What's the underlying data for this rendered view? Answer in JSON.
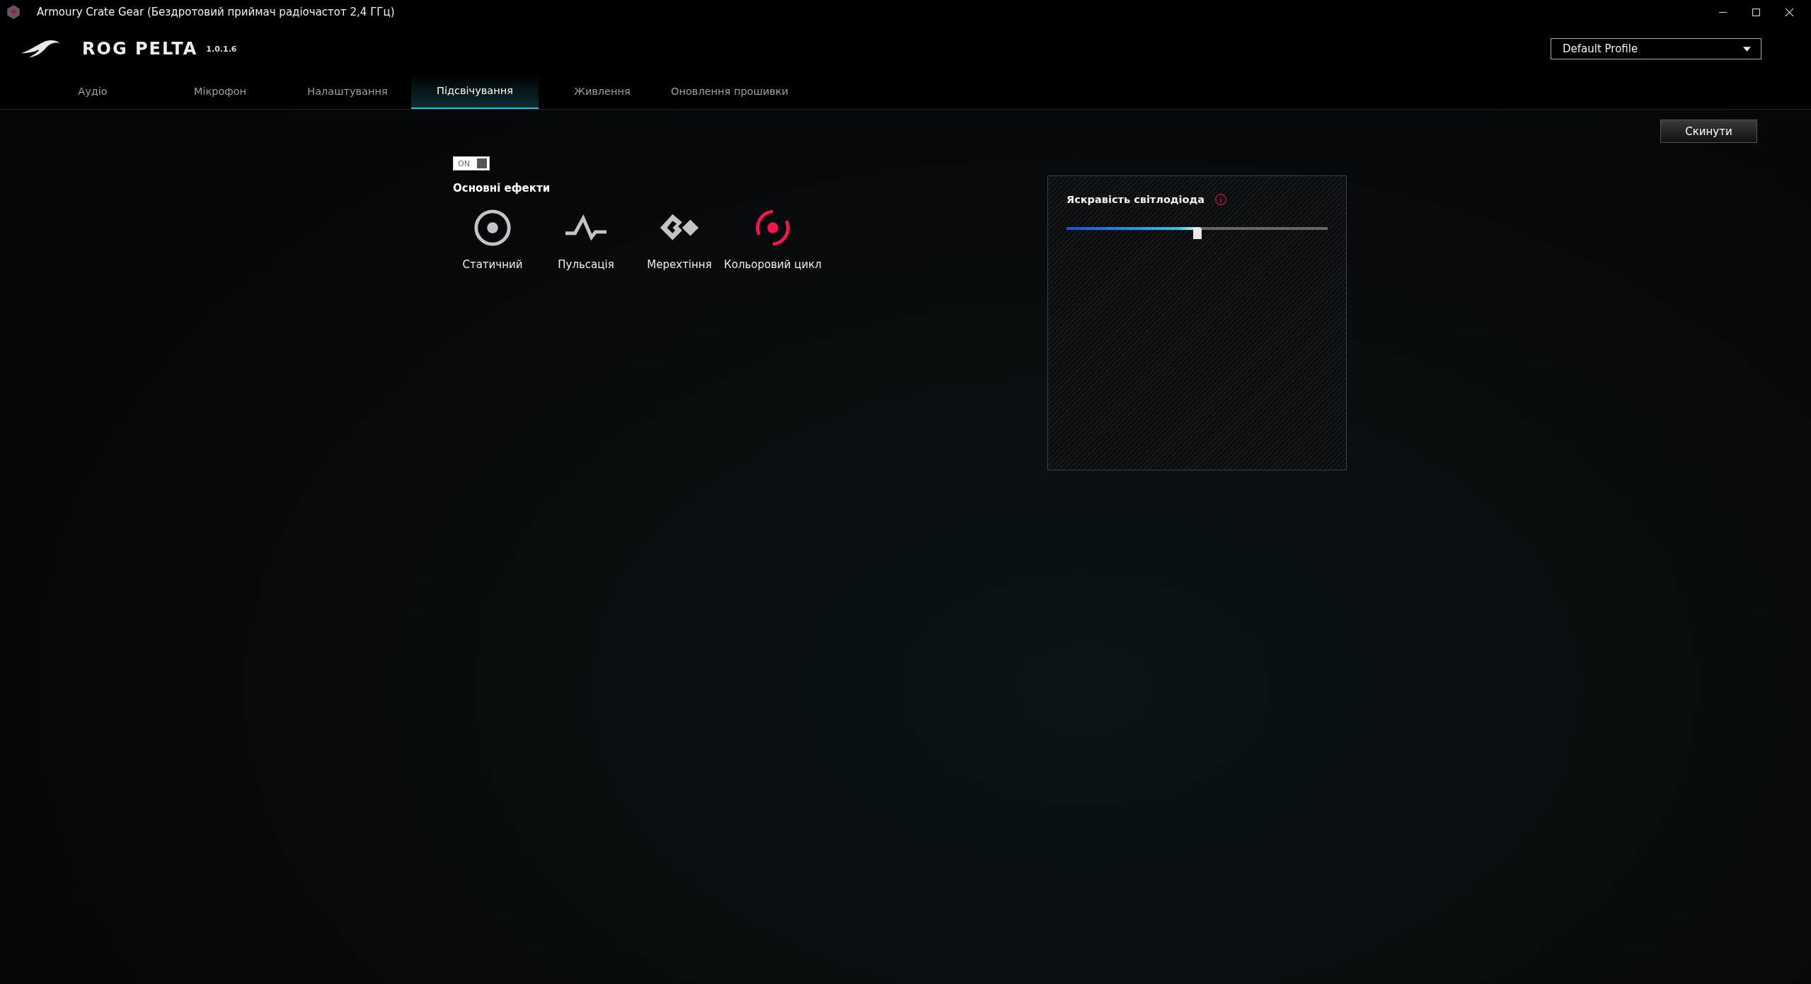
{
  "window": {
    "title": "Armoury Crate Gear (Бездротовий приймач радіочастот 2,4 ГГц)"
  },
  "header": {
    "product": "ROG PELTA",
    "version": "1.0.1.6",
    "profile": "Default Profile"
  },
  "tabs": [
    {
      "label": "Аудіо",
      "selected": false
    },
    {
      "label": "Мікрофон",
      "selected": false
    },
    {
      "label": "Налаштування",
      "selected": false
    },
    {
      "label": "Підсвічування",
      "selected": true
    },
    {
      "label": "Живлення",
      "selected": false
    },
    {
      "label": "Оновлення прошивки",
      "selected": false
    }
  ],
  "reset_button": "Скинути",
  "lighting_switch": {
    "label": "ON",
    "on": true
  },
  "effects_title": "Основні ефекти",
  "effects": [
    {
      "kind": "static",
      "label": "Статичний",
      "selected": false
    },
    {
      "kind": "breathing",
      "label": "Пульсація",
      "selected": false
    },
    {
      "kind": "strobing",
      "label": "Мерехтіння",
      "selected": false
    },
    {
      "kind": "color_cycle",
      "label": "Кольоровий цикл",
      "selected": true
    }
  ],
  "brightness": {
    "title": "Яскравість світлодіода",
    "level": 0.5
  }
}
